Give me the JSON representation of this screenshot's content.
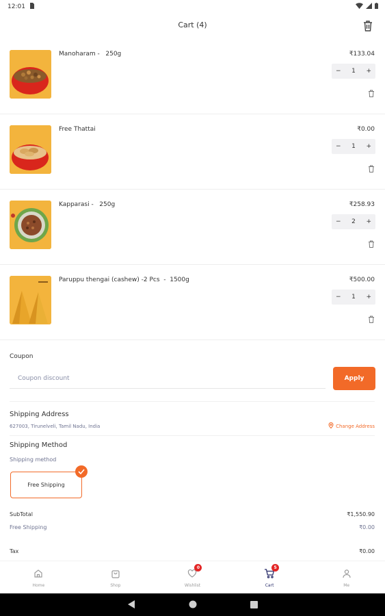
{
  "status_bar": {
    "time": "12:01"
  },
  "header": {
    "title": "Cart (4)"
  },
  "cart_items": [
    {
      "name": "Manoharam -   250g",
      "price": "₹133.04",
      "qty": "1",
      "image": "manoharam-snack-bowl"
    },
    {
      "name": "Free Thattai",
      "price": "₹0.00",
      "qty": "1",
      "image": "thattai-snack-bowl"
    },
    {
      "name": "Kapparasi -   250g",
      "price": "₹258.93",
      "qty": "2",
      "image": "kapparasi-snack-plate"
    },
    {
      "name": "Paruppu thengai (cashew) -2 Pcs  -  1500g",
      "price": "₹500.00",
      "qty": "1",
      "image": "paruppu-thengai-cones"
    }
  ],
  "stepper": {
    "minus": "−",
    "plus": "+"
  },
  "coupon": {
    "label": "Coupon",
    "placeholder": "Coupon discount",
    "apply": "Apply"
  },
  "shipping_address": {
    "title": "Shipping Address",
    "address": "627003, Tirunelveli, Tamil Nadu, India",
    "change": "Change Address"
  },
  "shipping_method": {
    "title": "Shipping Method",
    "subtitle": "Shipping method",
    "option": "Free Shipping"
  },
  "summary": [
    {
      "label": "SubTotal",
      "value": "₹1,550.90",
      "muted": false
    },
    {
      "label": "Free Shipping",
      "value": "₹0.00",
      "muted": true
    },
    {
      "label": "Tax",
      "value": "₹0.00",
      "muted": false
    }
  ],
  "nav": [
    {
      "label": "Home",
      "icon": "home-icon",
      "badge": ""
    },
    {
      "label": "Shop",
      "icon": "shopping-bag-icon",
      "badge": ""
    },
    {
      "label": "Wishlist",
      "icon": "heart-icon",
      "badge": "0"
    },
    {
      "label": "Cart",
      "icon": "cart-icon",
      "badge": "5",
      "active": true
    },
    {
      "label": "Me",
      "icon": "user-icon",
      "badge": ""
    }
  ],
  "colors": {
    "accent": "#f26a28",
    "badge": "#e32626",
    "nav_active": "#2b2f6b",
    "thumb_bg": "#f3b43d"
  }
}
